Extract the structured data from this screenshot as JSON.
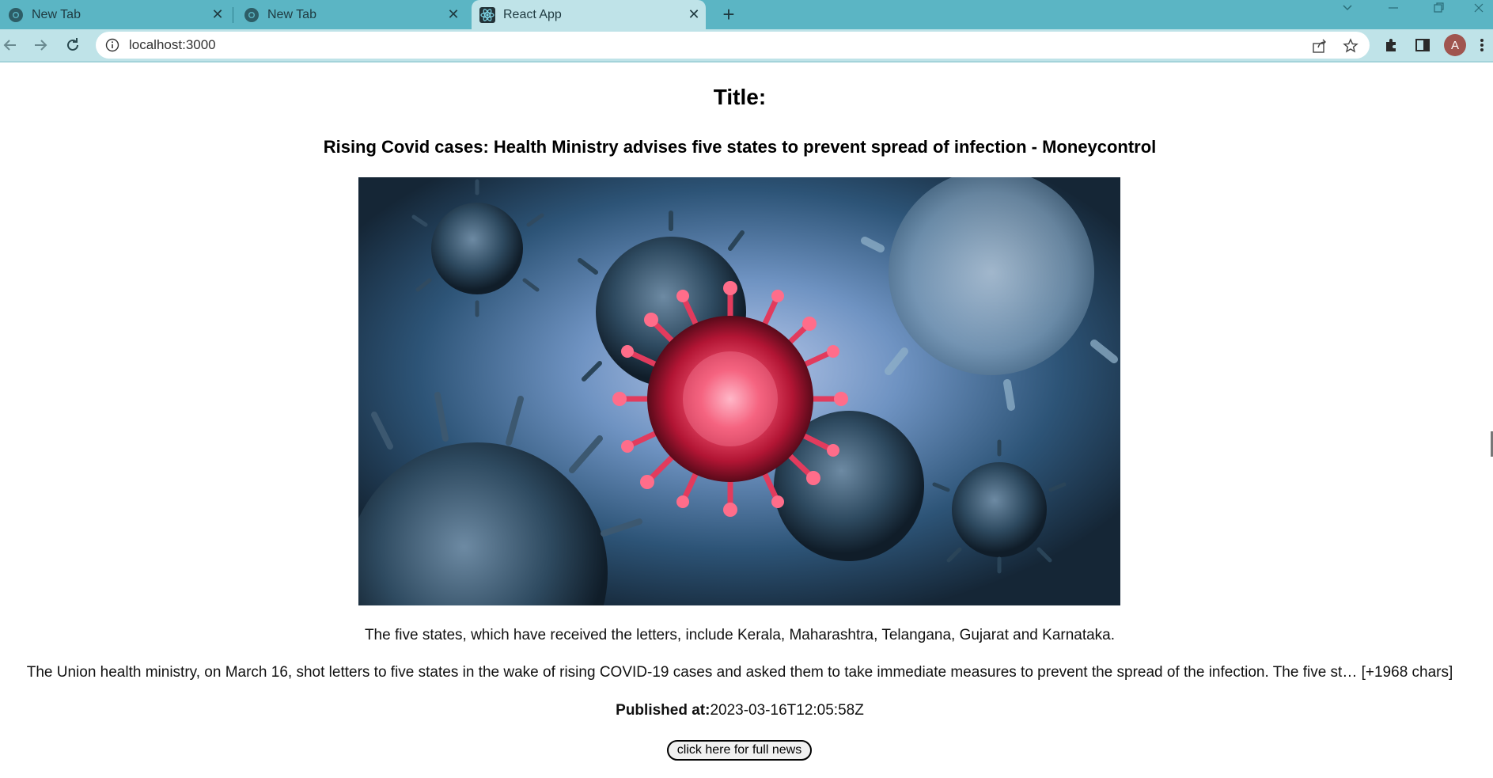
{
  "browser": {
    "tabs": [
      {
        "label": "New Tab",
        "active": false,
        "icon": "chrome-icon"
      },
      {
        "label": "New Tab",
        "active": false,
        "icon": "chrome-icon"
      },
      {
        "label": "React App",
        "active": true,
        "icon": "react-icon"
      }
    ],
    "address": "localhost:3000",
    "profile_initial": "A",
    "tab_strip_color": "#5bb5c4",
    "toolbar_color": "#bfe3e8"
  },
  "page": {
    "heading": "Title:",
    "headline": "Rising Covid cases: Health Ministry advises five states to prevent spread of infection - Moneycontrol",
    "image": "coronavirus-illustration",
    "description": "The five states, which have received the letters, include Kerala, Maharashtra, Telangana, Gujarat and Karnataka.",
    "content": "The Union health ministry, on March 16, shot letters to five states in the wake of rising COVID-19 cases and asked them to take immediate measures to prevent the spread of the infection. The five st… [+1968 chars]",
    "published_label": "Published at:",
    "published_value": "2023-03-16T12:05:58Z",
    "button_label": "click here for full news"
  }
}
